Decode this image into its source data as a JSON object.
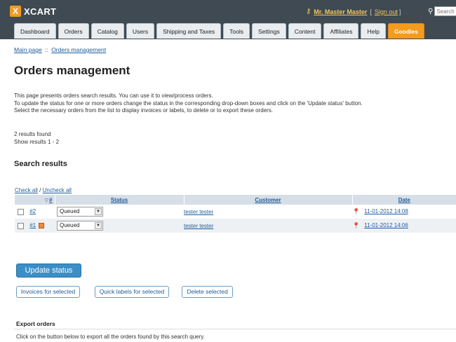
{
  "header": {
    "logo_mark": "X",
    "logo_text": "XCART",
    "user_name": "Mr. Master Master",
    "sign_out": "Sign out",
    "search_placeholder": "Search"
  },
  "tabs": [
    {
      "label": "Dashboard"
    },
    {
      "label": "Orders"
    },
    {
      "label": "Catalog"
    },
    {
      "label": "Users"
    },
    {
      "label": "Shipping and Taxes"
    },
    {
      "label": "Tools"
    },
    {
      "label": "Settings"
    },
    {
      "label": "Content"
    },
    {
      "label": "Affiliates"
    },
    {
      "label": "Help"
    },
    {
      "label": "Goodies"
    }
  ],
  "breadcrumb": {
    "main": "Main page",
    "sep": "::",
    "current": "Orders management"
  },
  "page_title": "Orders management",
  "description": [
    "This page presents orders search results. You can use it to view/process orders.",
    "To update the status for one or more orders change the status in the corresponding drop-down boxes and click on the 'Update status' button.",
    "Select the necessary orders from the list to display invoices or labels, to delete or to export these orders."
  ],
  "results": {
    "found": "2 results found",
    "show": "Show results 1 - 2"
  },
  "section_title": "Search results",
  "check_links": {
    "check_all": "Check all",
    "sep": "/",
    "uncheck_all": "Uncheck all"
  },
  "table": {
    "headers": {
      "num": "#",
      "status": "Status",
      "customer": "Customer",
      "date": "Date"
    },
    "rows": [
      {
        "num": "#2",
        "status": "Queued",
        "customer": "tester tester",
        "date": "11-01-2012 14:08"
      },
      {
        "num": "#1",
        "status": "Queued",
        "customer": "tester tester",
        "date": "11-01-2012 14:06"
      }
    ]
  },
  "buttons": {
    "update_status": "Update status",
    "invoices": "Invoices for selected",
    "labels": "Quick labels for selected",
    "delete": "Delete selected"
  },
  "export": {
    "title": "Export orders",
    "desc": "Click on the button below to export all the orders found by this search query."
  },
  "colors": {
    "header_bg": "#3f4a52",
    "accent_orange": "#f39b1d",
    "link_blue": "#1f5c9c",
    "button_blue": "#3b8fc8"
  }
}
